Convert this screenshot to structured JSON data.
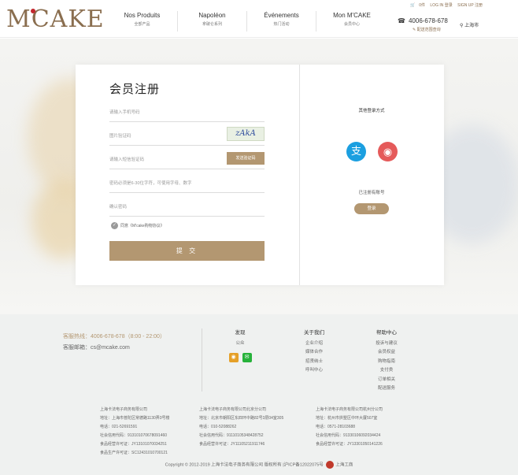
{
  "header": {
    "logo": "M'CAKE",
    "top_links": [
      "LOG IN 登录",
      "SIGN UP 注册"
    ],
    "cart_count": "0件",
    "nav": [
      {
        "title": "Nos Produits",
        "sub": "全部产品"
      },
      {
        "title": "Napoléon",
        "sub": "拿破仑系列"
      },
      {
        "title": "Événements",
        "sub": "热门活动"
      },
      {
        "title": "Mon M'CAKE",
        "sub": "会员中心"
      }
    ],
    "hotline": "4006-678-678",
    "delivery": "配送范围查询",
    "city": "上海市"
  },
  "register": {
    "title": "会员注册",
    "phone_placeholder": "请输入手机号码",
    "captcha_placeholder": "图片验证码",
    "captcha_text": "zAkA",
    "sms_placeholder": "请输入短信验证码",
    "sms_button": "发送验证码",
    "password_placeholder": "密码必须是6-30位字符，可使用字母、数字",
    "confirm_placeholder": "确认密码",
    "agree_text": "同意《M'cake购物协议》",
    "submit": "提 交"
  },
  "side": {
    "other_login": "其他登录方式",
    "alipay_icon": "alipay-icon",
    "weibo_icon": "weibo-icon",
    "registered": "已注册有账号",
    "login": "登录"
  },
  "footer": {
    "hotline_label": "客服热线：",
    "hotline_value": "4006-678-678（8:00 - 22:00）",
    "email_label": "客服邮箱：",
    "email_value": "cs@mcake.com",
    "columns": [
      {
        "title": "发现",
        "items": [
          "公众"
        ]
      },
      {
        "title": "关于我们",
        "items": [
          "企业介绍",
          "媒体合作",
          "招贤纳士",
          "呼叫中心"
        ]
      },
      {
        "title": "帮助中心",
        "items": [
          "投诉与建议",
          "会员权益",
          "购物指南",
          "支付类",
          "订单相关",
          "配送服务"
        ]
      }
    ],
    "companies": [
      [
        "上海卡法电子商务有限公司",
        "地址：上海市普陀区常德路1130弄3号楼",
        "电话：021-52691591",
        "社会信用代码：913101070678091460",
        "食品经营许可证：JY13101070034251",
        "食品生产许可证：SC12431010700121"
      ],
      [
        "上海卡法电子商务有限公司北京分公司",
        "地址：北京市朝阳区东四环中路82号3层04室305",
        "电话：010-52088262",
        "社会信用代码：91110105348428752",
        "食品经营许可证：JY11105211911746"
      ],
      [
        "上海卡法电子商务有限公司杭州分公司",
        "地址：杭州市拱墅区中环大厦507室",
        "电话：0571-28103688",
        "社会信用代码：91330106092034424",
        "食品经营许可证：JY13301050141226"
      ]
    ],
    "copyright": "Copyright © 2012-2019 上海卡法电子商务有限公司 版权所有 |沪ICP备12022075号",
    "gov_badge": "上海工商"
  },
  "colors": {
    "brand": "#b39771",
    "logo": "#8a6e4f",
    "alipay": "#1b9fe0",
    "weibo": "#e55a5a"
  }
}
